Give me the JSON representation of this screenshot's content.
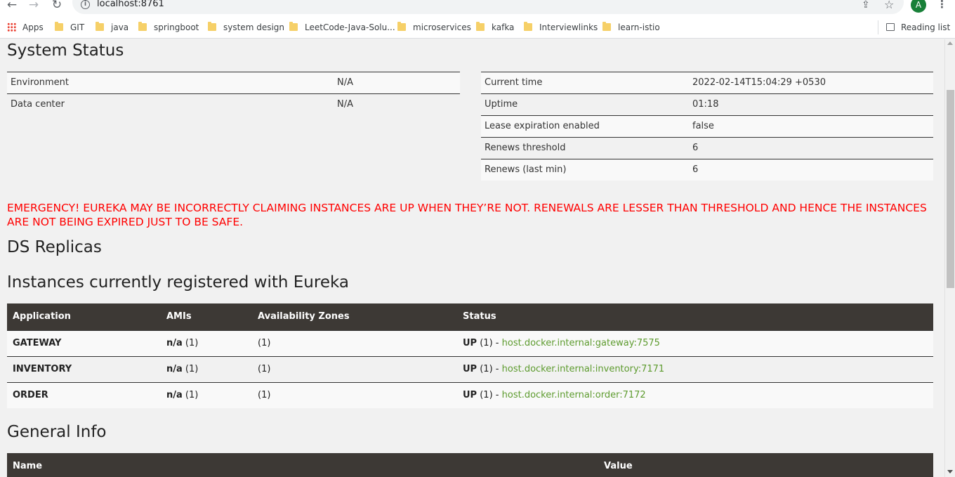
{
  "browser": {
    "url": "localhost:8761",
    "avatar_letter": "A",
    "bookmarks": [
      {
        "label": "Apps",
        "type": "apps"
      },
      {
        "label": "GIT",
        "type": "folder"
      },
      {
        "label": "java",
        "type": "folder"
      },
      {
        "label": "springboot",
        "type": "folder"
      },
      {
        "label": "system design",
        "type": "folder"
      },
      {
        "label": "LeetCode-Java-Solu...",
        "type": "folder"
      },
      {
        "label": "microservices",
        "type": "folder"
      },
      {
        "label": "kafka",
        "type": "folder"
      },
      {
        "label": "Interviewlinks",
        "type": "folder"
      },
      {
        "label": "learn-istio",
        "type": "folder"
      }
    ],
    "reading_list": "Reading list"
  },
  "system_status": {
    "title": "System Status",
    "left": [
      {
        "key": "Environment",
        "value": "N/A"
      },
      {
        "key": "Data center",
        "value": "N/A"
      }
    ],
    "right": [
      {
        "key": "Current time",
        "value": "2022-02-14T15:04:29 +0530"
      },
      {
        "key": "Uptime",
        "value": "01:18"
      },
      {
        "key": "Lease expiration enabled",
        "value": "false"
      },
      {
        "key": "Renews threshold",
        "value": "6"
      },
      {
        "key": "Renews (last min)",
        "value": "6"
      }
    ]
  },
  "emergency": "EMERGENCY! EUREKA MAY BE INCORRECTLY CLAIMING INSTANCES ARE UP WHEN THEY’RE NOT. RENEWALS ARE LESSER THAN THRESHOLD AND HENCE THE INSTANCES ARE NOT BEING EXPIRED JUST TO BE SAFE.",
  "ds_replicas": {
    "title": "DS Replicas"
  },
  "instances": {
    "title": "Instances currently registered with Eureka",
    "columns": [
      "Application",
      "AMIs",
      "Availability Zones",
      "Status"
    ],
    "rows": [
      {
        "app": "GATEWAY",
        "ami": "n/a",
        "ami_count": "(1)",
        "az": "(1)",
        "status": "UP",
        "status_count": "(1) -",
        "link": "host.docker.internal:gateway:7575"
      },
      {
        "app": "INVENTORY",
        "ami": "n/a",
        "ami_count": "(1)",
        "az": "(1)",
        "status": "UP",
        "status_count": "(1) -",
        "link": "host.docker.internal:inventory:7171"
      },
      {
        "app": "ORDER",
        "ami": "n/a",
        "ami_count": "(1)",
        "az": "(1)",
        "status": "UP",
        "status_count": "(1) -",
        "link": "host.docker.internal:order:7172"
      }
    ]
  },
  "general_info": {
    "title": "General Info",
    "columns": [
      "Name",
      "Value"
    ]
  },
  "colors": {
    "header_bg": "#3d3935",
    "emergency": "#ff0000",
    "link": "#5d9b2e"
  }
}
